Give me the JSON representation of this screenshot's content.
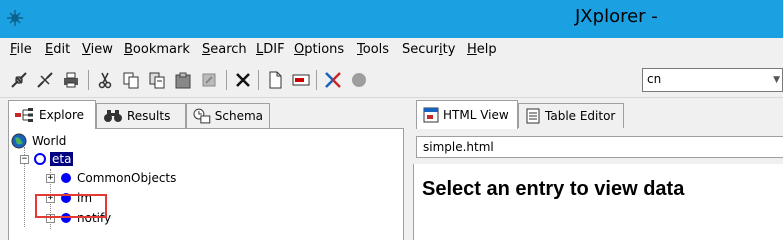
{
  "window": {
    "title": "JXplorer -",
    "app_icon": "jxplorer-logo-icon"
  },
  "menu": [
    {
      "label": "File",
      "accel": "F",
      "rest": "ile"
    },
    {
      "label": "Edit",
      "accel": "E",
      "rest": "dit"
    },
    {
      "label": "View",
      "accel": "V",
      "rest": "iew"
    },
    {
      "label": "Bookmark",
      "accel": "B",
      "rest": "ookmark"
    },
    {
      "label": "Search",
      "accel": "S",
      "rest": "earch"
    },
    {
      "label": "LDIF",
      "accel": "L",
      "rest": "DIF"
    },
    {
      "label": "Options",
      "accel": "O",
      "rest": "ptions"
    },
    {
      "label": "Tools",
      "accel": "T",
      "rest": "ools"
    },
    {
      "label": "Security",
      "pre": "Secur",
      "accel": "i",
      "rest": "ty"
    },
    {
      "label": "Help",
      "accel": "H",
      "rest": "elp"
    }
  ],
  "toolbar": {
    "icons": [
      "connect-icon",
      "disconnect-icon",
      "print-icon",
      "cut-icon",
      "copy-icon",
      "copy-dn-icon",
      "paste-icon",
      "paste-alias-icon",
      "delete-icon",
      "new-entry-icon",
      "rename-icon",
      "refresh-icon",
      "stop-icon"
    ],
    "search_value": "cn"
  },
  "left_tabs": [
    {
      "label": "Explore",
      "icon": "explore-icon"
    },
    {
      "label": "Results",
      "icon": "binoculars-icon"
    },
    {
      "label": "Schema",
      "icon": "schema-icon"
    }
  ],
  "tree": {
    "root": "World",
    "selected": "eta",
    "children": [
      "CommonObjects",
      "im",
      "notify"
    ]
  },
  "right_tabs": [
    {
      "label": "HTML View",
      "icon": "html-view-icon"
    },
    {
      "label": "Table Editor",
      "icon": "table-editor-icon"
    }
  ],
  "html_view": {
    "file": "simple.html",
    "message": "Select an entry to view data"
  },
  "colors": {
    "titlebar": "#1ba1e2",
    "selection": "#000080",
    "node_dot": "#0000ff",
    "highlight": "#e53935"
  }
}
